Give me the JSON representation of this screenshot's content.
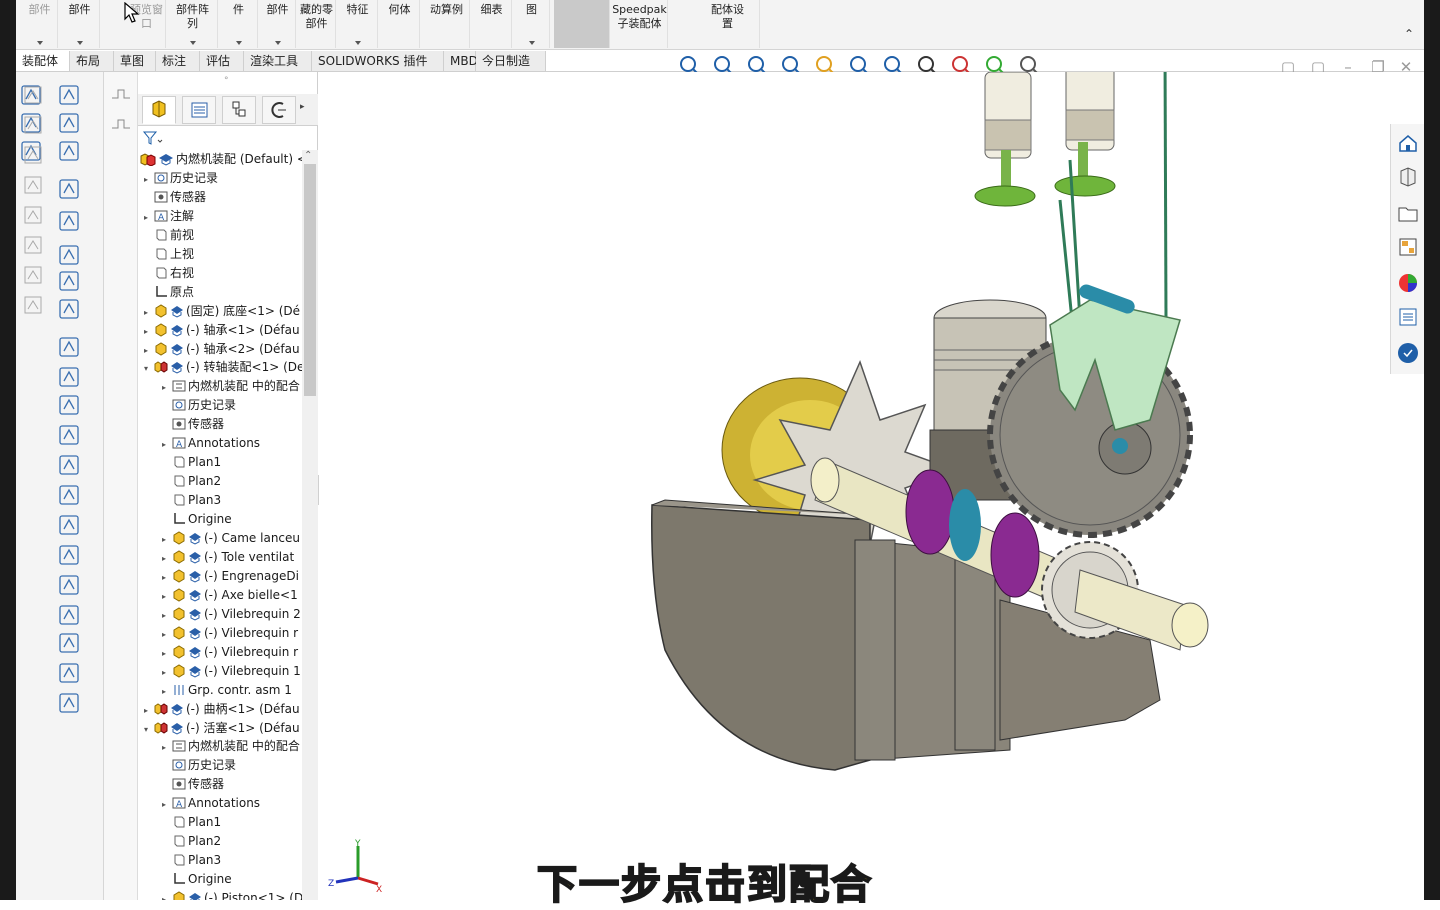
{
  "ribbon": {
    "buttons": [
      {
        "label": "部件",
        "dim": true
      },
      {
        "label": "部件",
        "dim": false
      },
      {
        "label": "预览窗\n口",
        "dim": true
      },
      {
        "label": "部件阵\n列",
        "dim": false
      },
      {
        "label": "件",
        "dim": false
      },
      {
        "label": "部件",
        "dim": false
      },
      {
        "label": "藏的零\n部件",
        "dim": false
      },
      {
        "label": "特征",
        "dim": false
      },
      {
        "label": "何体",
        "dim": false
      },
      {
        "label": "动算例",
        "dim": false
      },
      {
        "label": "细表",
        "dim": false
      },
      {
        "label": "图",
        "dim": false
      },
      {
        "label": "Speedpak\n子装配体",
        "dim": false
      },
      {
        "label": "配体设\n置",
        "dim": false
      }
    ]
  },
  "tabs": [
    "装配体",
    "布局",
    "草图",
    "标注",
    "评估",
    "渲染工具",
    "SOLIDWORKS 插件",
    "MBD",
    "今日制造"
  ],
  "active_tab_index": 0,
  "tree": {
    "root": "内燃机装配 (Default) <",
    "nodes": [
      {
        "label": "历史记录",
        "level": 1,
        "icon": "history-icon",
        "exp": "▸"
      },
      {
        "label": "传感器",
        "level": 1,
        "icon": "sensor-icon",
        "exp": ""
      },
      {
        "label": "注解",
        "level": 1,
        "icon": "annotation-icon",
        "exp": "▸"
      },
      {
        "label": "前视",
        "level": 1,
        "icon": "plane-icon",
        "exp": ""
      },
      {
        "label": "上视",
        "level": 1,
        "icon": "plane-icon",
        "exp": ""
      },
      {
        "label": "右视",
        "level": 1,
        "icon": "plane-icon",
        "exp": ""
      },
      {
        "label": "原点",
        "level": 1,
        "icon": "origin-icon",
        "exp": ""
      },
      {
        "label": "(固定) 底座<1> (Dé",
        "level": 1,
        "icon": "part-icon",
        "exp": "▸"
      },
      {
        "label": "(-) 轴承<1> (Défau",
        "level": 1,
        "icon": "part-icon",
        "exp": "▸"
      },
      {
        "label": "(-) 轴承<2> (Défau",
        "level": 1,
        "icon": "part-icon",
        "exp": "▸"
      },
      {
        "label": "(-) 转轴装配<1> (De",
        "level": 1,
        "icon": "assembly-icon",
        "exp": "▾"
      },
      {
        "label": "内燃机装配 中的配合",
        "level": 2,
        "icon": "mates-icon",
        "exp": "▸"
      },
      {
        "label": "历史记录",
        "level": 2,
        "icon": "history-icon",
        "exp": ""
      },
      {
        "label": "传感器",
        "level": 2,
        "icon": "sensor-icon",
        "exp": ""
      },
      {
        "label": "Annotations",
        "level": 2,
        "icon": "annotation-icon",
        "exp": "▸"
      },
      {
        "label": "Plan1",
        "level": 2,
        "icon": "plane-icon",
        "exp": ""
      },
      {
        "label": "Plan2",
        "level": 2,
        "icon": "plane-icon",
        "exp": ""
      },
      {
        "label": "Plan3",
        "level": 2,
        "icon": "plane-icon",
        "exp": ""
      },
      {
        "label": "Origine",
        "level": 2,
        "icon": "origin-icon",
        "exp": ""
      },
      {
        "label": "(-) Came lanceu",
        "level": 2,
        "icon": "part-icon",
        "exp": "▸"
      },
      {
        "label": "(-) Tole ventilat",
        "level": 2,
        "icon": "part-icon",
        "exp": "▸"
      },
      {
        "label": "(-) EngrenageDi",
        "level": 2,
        "icon": "part-icon",
        "exp": "▸"
      },
      {
        "label": "(-) Axe bielle<1",
        "level": 2,
        "icon": "part-icon",
        "exp": "▸"
      },
      {
        "label": "(-) Vilebrequin 2",
        "level": 2,
        "icon": "part-icon",
        "exp": "▸"
      },
      {
        "label": "(-) Vilebrequin r",
        "level": 2,
        "icon": "part-icon",
        "exp": "▸"
      },
      {
        "label": "(-) Vilebrequin r",
        "level": 2,
        "icon": "part-icon",
        "exp": "▸"
      },
      {
        "label": "(-) Vilebrequin 1",
        "level": 2,
        "icon": "part-icon",
        "exp": "▸"
      },
      {
        "label": "Grp. contr. asm 1",
        "level": 2,
        "icon": "folder-icon",
        "exp": "▸"
      },
      {
        "label": "(-) 曲柄<1> (Défau",
        "level": 1,
        "icon": "assembly-icon",
        "exp": "▸"
      },
      {
        "label": "(-) 活塞<1> (Défau",
        "level": 1,
        "icon": "assembly-icon",
        "exp": "▾"
      },
      {
        "label": "内燃机装配 中的配合",
        "level": 2,
        "icon": "mates-icon",
        "exp": "▸"
      },
      {
        "label": "历史记录",
        "level": 2,
        "icon": "history-icon",
        "exp": ""
      },
      {
        "label": "传感器",
        "level": 2,
        "icon": "sensor-icon",
        "exp": ""
      },
      {
        "label": "Annotations",
        "level": 2,
        "icon": "annotation-icon",
        "exp": "▸"
      },
      {
        "label": "Plan1",
        "level": 2,
        "icon": "plane-icon",
        "exp": ""
      },
      {
        "label": "Plan2",
        "level": 2,
        "icon": "plane-icon",
        "exp": ""
      },
      {
        "label": "Plan3",
        "level": 2,
        "icon": "plane-icon",
        "exp": ""
      },
      {
        "label": "Origine",
        "level": 2,
        "icon": "origin-icon",
        "exp": ""
      },
      {
        "label": "(-) Piston<1> (D",
        "level": 2,
        "icon": "part-icon",
        "exp": "▸"
      }
    ]
  },
  "subtitle": "下一步点击到配合",
  "colors": {
    "accent_blue": "#1f6fd1",
    "subtitle_yellow": "#f6e32a",
    "part_gray": "#7d786c",
    "gear_gray": "#8a877f",
    "purple": "#8a2a91",
    "mint": "#bfe6c2",
    "teal": "#2a8ca8"
  }
}
